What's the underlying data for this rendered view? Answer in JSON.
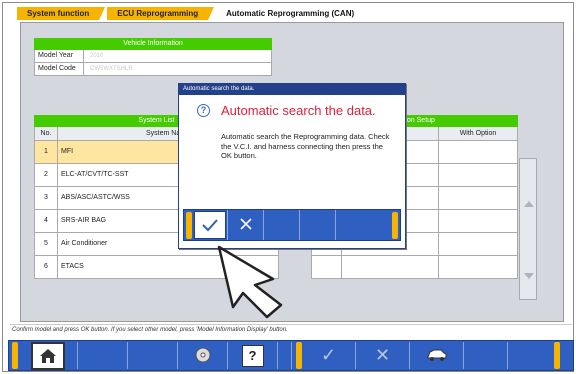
{
  "tabs": [
    {
      "label": "System function"
    },
    {
      "label": "ECU Reprogramming"
    },
    {
      "label": "Automatic Reprogramming (CAN)"
    }
  ],
  "vehicle_info": {
    "header": "Vehicle Information",
    "model_year_label": "Model Year",
    "model_year_value": "2010",
    "model_code_label": "Model Code",
    "model_code_value": "CW5WXTSHLR"
  },
  "system_list": {
    "header": "System List",
    "col_no": "No.",
    "col_name": "System Name",
    "rows": [
      {
        "no": "1",
        "name": "MFI"
      },
      {
        "no": "2",
        "name": "ELC-AT/CVT/TC-SST"
      },
      {
        "no": "3",
        "name": "ABS/ASC/ASTC/WSS"
      },
      {
        "no": "4",
        "name": "SRS-AIR BAG"
      },
      {
        "no": "5",
        "name": "Air Conditioner"
      },
      {
        "no": "6",
        "name": "ETACS"
      }
    ]
  },
  "option_setup": {
    "header": "Option Setup",
    "col_name_partial": "me",
    "col_with_option": "With Option"
  },
  "status_text": "Confirm model and press OK button. If you select other model, press 'Model Information Display' button.",
  "dialog": {
    "title": "Automatic search the data.",
    "heading": "Automatic search the data.",
    "body": "Automatic search the Reprogramming data. Check the V.C.I. and harness connecting then press the OK button."
  },
  "colors": {
    "tab_active": "#f6b400",
    "header_green": "#44cc00",
    "toolbar_blue": "#2f5fc0",
    "dialog_heading_red": "#e0203a"
  },
  "icons": [
    "home-icon",
    "cd-icon",
    "help-icon",
    "check-icon",
    "cross-icon",
    "car-icon",
    "question-icon",
    "hand-pointer-icon"
  ]
}
